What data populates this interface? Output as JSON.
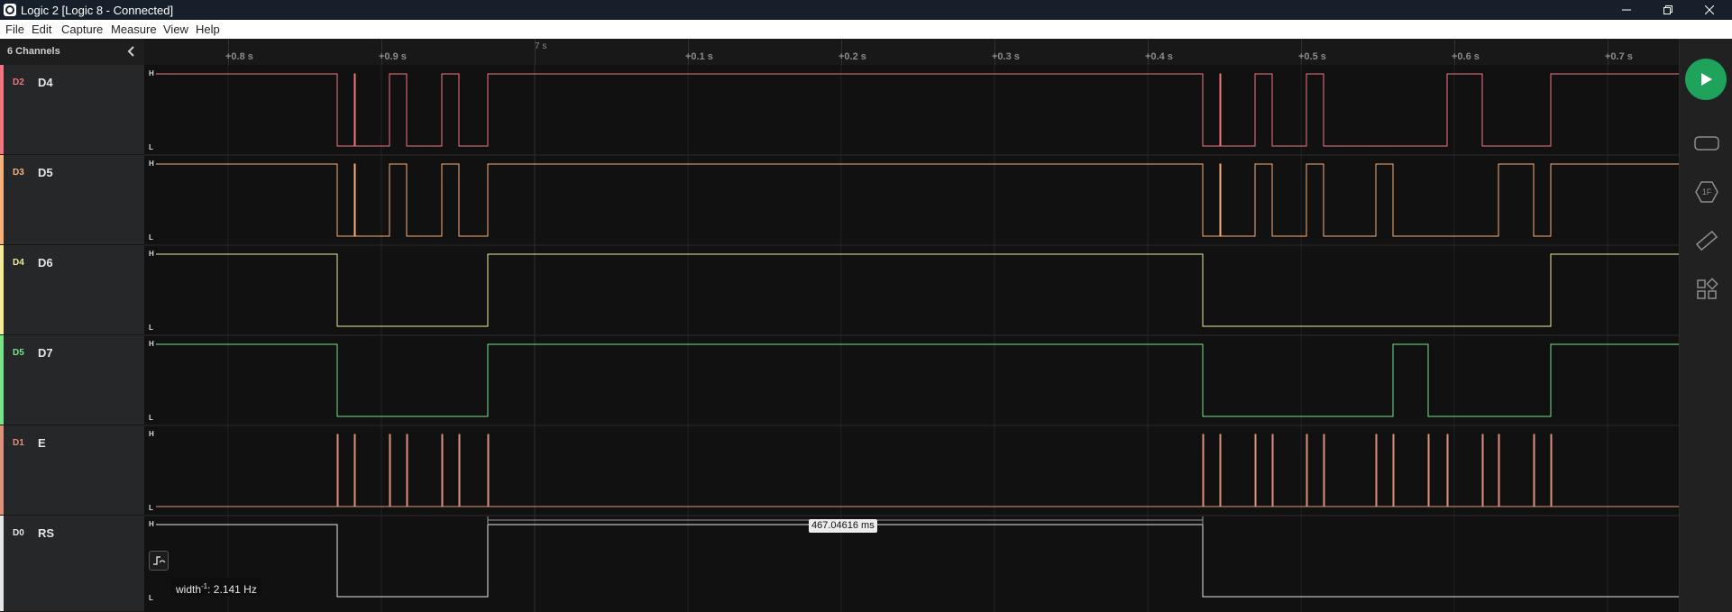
{
  "window": {
    "title": "Logic 2 [Logic 8 - Connected]"
  },
  "menu": [
    "File",
    "Edit",
    "Capture",
    "Measure",
    "View",
    "Help"
  ],
  "sidebar": {
    "channel_count": "6 Channels"
  },
  "timeline": {
    "ticks": [
      "+0.8 s",
      "+0.9 s",
      "+0.1 s",
      "+0.2 s",
      "+0.3 s",
      "+0.4 s",
      "+0.5 s",
      "+0.6 s",
      "+0.7 s"
    ],
    "marker": "7 s"
  },
  "levels": {
    "high": "H",
    "low": "L"
  },
  "channels": [
    {
      "digital": "D2",
      "name": "D4",
      "color": "#f2767f"
    },
    {
      "digital": "D3",
      "name": "D5",
      "color": "#f7b17a"
    },
    {
      "digital": "D4",
      "name": "D6",
      "color": "#f3ec96"
    },
    {
      "digital": "D5",
      "name": "D7",
      "color": "#79e38a"
    },
    {
      "digital": "D1",
      "name": "E",
      "color": "#e0917d"
    },
    {
      "digital": "D0",
      "name": "RS",
      "color": "#e6e6e6"
    }
  ],
  "measurement": {
    "duration": "467.04616 ms",
    "width_prefix": "width",
    "width_exp": "-1",
    "width_value": ": 2.141 Hz"
  },
  "icons": {
    "play": "play-icon",
    "toolbar": [
      "device-icon",
      "analyzer-icon",
      "measure-ruler-icon",
      "extensions-icon"
    ]
  }
}
